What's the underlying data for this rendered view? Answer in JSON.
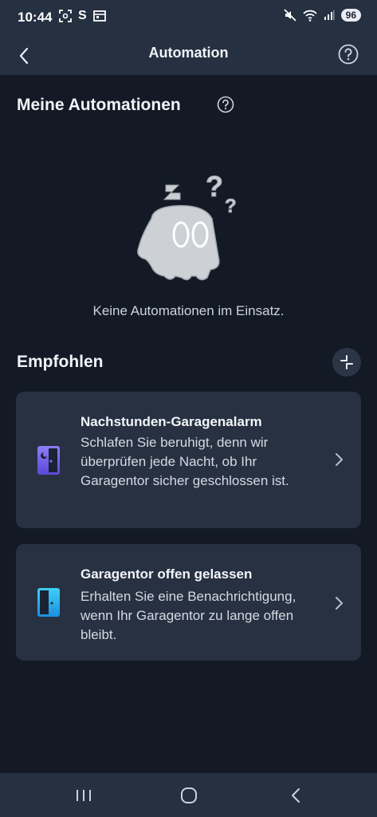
{
  "status_bar": {
    "time": "10:44",
    "left_icons": [
      "screenshot-icon",
      "s-app-icon",
      "calendar-icon"
    ],
    "right_icons": [
      "mute-icon",
      "wifi-icon",
      "signal-icon"
    ],
    "battery": "96"
  },
  "app_bar": {
    "title": "Automation"
  },
  "my_automations": {
    "title": "Meine Automationen",
    "empty_text": "Keine Automationen im Einsatz."
  },
  "recommended": {
    "title": "Empfohlen",
    "cards": [
      {
        "icon": "door-moon-icon",
        "title": "Nachstunden-Garagenalarm",
        "description": "Schlafen Sie beruhigt, denn wir überprüfen jede Nacht, ob Ihr Garagentor sicher geschlossen ist."
      },
      {
        "icon": "door-open-icon",
        "title": "Garagentor offen gelassen",
        "description": "Erhalten Sie eine Benachrichtigung, wenn Ihr Garagentor zu lange offen bleibt."
      }
    ]
  },
  "colors": {
    "background": "#131a26",
    "bar": "#253041",
    "card": "#273142",
    "accent_purple": "#7b6cf0",
    "accent_cyan": "#2ab3ef"
  }
}
